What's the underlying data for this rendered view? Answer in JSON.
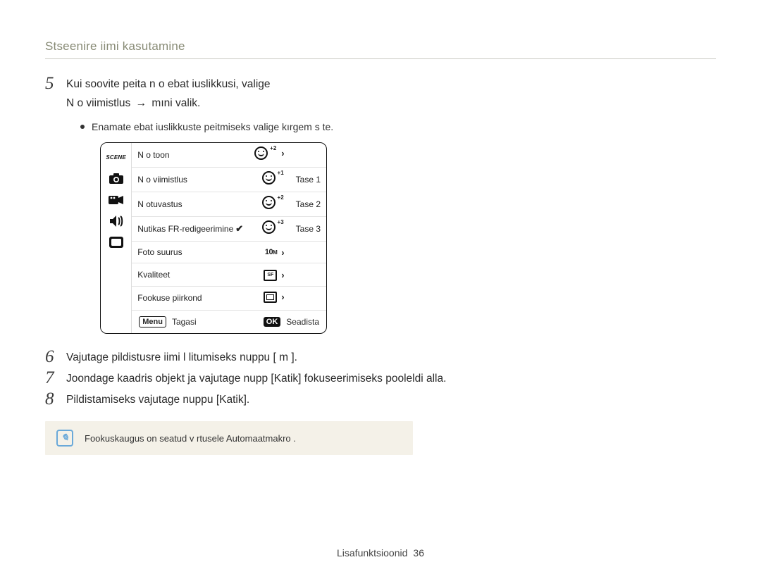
{
  "section_title": "Stseenire iimi kasutamine",
  "steps": {
    "s5": {
      "num": "5",
      "line1": "Kui soovite peita n o ebat iuslikkusi, valige",
      "line2_a": "N o viimistlus ",
      "line2_arrow": "→",
      "line2_b": " mıni valik.",
      "bullet": "Enamate ebat iuslikkuste peitmiseks valige kırgem s te."
    },
    "s6": {
      "num": "6",
      "text": "Vajutage pildistusre iimi l litumiseks nuppu [   m       ]."
    },
    "s7": {
      "num": "7",
      "text": "Joondage kaadris objekt ja vajutage nupp [Katik] fokuseerimiseks pooleldi alla."
    },
    "s8": {
      "num": "8",
      "text": "Pildistamiseks vajutage nuppu [Katik]."
    }
  },
  "menu": {
    "scene_label": "SCENE",
    "rows": {
      "r1": {
        "label": "N o toon",
        "lvl": "2"
      },
      "r2": {
        "label": "N o viimistlus",
        "lvl": "1",
        "opt": "Tase 1"
      },
      "r3": {
        "label": "N otuvastus",
        "lvl": "2",
        "opt": "Tase 2"
      },
      "r4": {
        "label": "Nutikas FR-redigeerimine",
        "lvl": "3",
        "opt": "Tase 3"
      },
      "r5": {
        "label": "Foto suurus",
        "val_a": "10",
        "val_b": "M"
      },
      "r6": {
        "label": "Kvaliteet",
        "val": "SF"
      },
      "r7": {
        "label": "Fookuse piirkond"
      }
    },
    "foot": {
      "menu_btn": "Menu",
      "back": "Tagasi",
      "ok_btn": "OK",
      "set": "Seadista"
    }
  },
  "note": {
    "text": "Fookuskaugus on seatud v  rtusele   Automaatmakro  ."
  },
  "footer": {
    "label": "Lisafunktsioonid",
    "num": "36"
  }
}
